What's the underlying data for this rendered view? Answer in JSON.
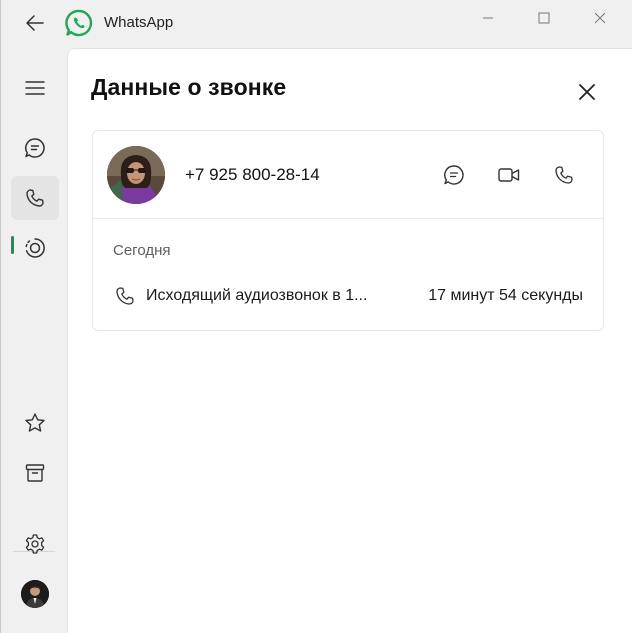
{
  "window": {
    "title": "WhatsApp"
  },
  "colors": {
    "brand": "#25d366",
    "active_indicator": "#1f8f4e",
    "panel_bg": "#ffffff",
    "window_bg": "#f0f0f0"
  },
  "rail": {
    "items": [
      {
        "icon": "menu-icon"
      },
      {
        "icon": "chats-icon"
      },
      {
        "icon": "calls-icon",
        "active": true
      },
      {
        "icon": "status-icon"
      },
      {
        "icon": "starred-icon"
      },
      {
        "icon": "archive-icon"
      },
      {
        "icon": "settings-icon"
      },
      {
        "icon": "profile-avatar"
      }
    ]
  },
  "panel": {
    "title": "Данные о звонке",
    "contact": {
      "phone": "+7 925 800-28-14",
      "actions": [
        {
          "icon": "message-icon"
        },
        {
          "icon": "video-call-icon"
        },
        {
          "icon": "voice-call-icon"
        }
      ]
    },
    "history": {
      "day": "Сегодня",
      "calls": [
        {
          "description": "Исходящий аудиозвонок в 1...",
          "duration": "17 минут 54 секунды"
        }
      ]
    }
  }
}
